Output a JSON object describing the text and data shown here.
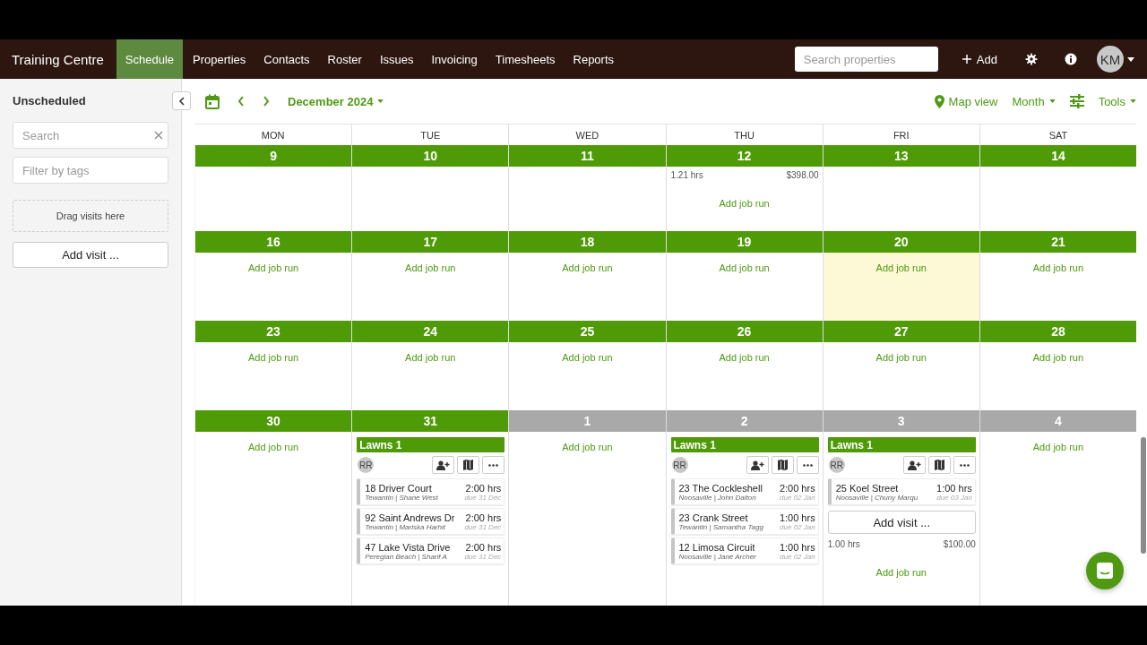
{
  "nav": {
    "brand": "Training Centre",
    "tabs": [
      {
        "label": "Schedule",
        "selected": true
      },
      {
        "label": "Properties",
        "selected": false
      },
      {
        "label": "Contacts",
        "selected": false
      },
      {
        "label": "Roster",
        "selected": false
      },
      {
        "label": "Issues",
        "selected": false
      },
      {
        "label": "Invoicing",
        "selected": false
      },
      {
        "label": "Timesheets",
        "selected": false
      },
      {
        "label": "Reports",
        "selected": false
      }
    ],
    "search": {
      "placeholder": "Search properties"
    },
    "add": "Add",
    "avatar": "KM"
  },
  "sidebar": {
    "title": "Unscheduled",
    "search": {
      "placeholder": "Search"
    },
    "tags": {
      "placeholder": "Filter by tags"
    },
    "drop": "Drag visits here",
    "add_visit": "Add visit ..."
  },
  "toolbar": {
    "period": "December 2024",
    "map_view": "Map view",
    "view": "Month",
    "tools": "Tools"
  },
  "weekdays": [
    "MON",
    "TUE",
    "WED",
    "THU",
    "FRI",
    "SAT"
  ],
  "weeks": [
    {
      "days": [
        {
          "date": "9",
          "other_month": false,
          "highlighted": false
        },
        {
          "date": "10",
          "other_month": false,
          "highlighted": false
        },
        {
          "date": "11",
          "other_month": false,
          "highlighted": false
        },
        {
          "date": "12",
          "other_month": false,
          "highlighted": false,
          "totals": {
            "hours": "1.21 hrs",
            "amount": "$398.00"
          },
          "add_job_run": "Add job run"
        },
        {
          "date": "13",
          "other_month": false,
          "highlighted": false
        },
        {
          "date": "14",
          "other_month": false,
          "highlighted": false
        }
      ]
    },
    {
      "days": [
        {
          "date": "16",
          "other_month": false,
          "highlighted": false,
          "add_job_run": "Add job run"
        },
        {
          "date": "17",
          "other_month": false,
          "highlighted": false,
          "add_job_run": "Add job run"
        },
        {
          "date": "18",
          "other_month": false,
          "highlighted": false,
          "add_job_run": "Add job run"
        },
        {
          "date": "19",
          "other_month": false,
          "highlighted": false,
          "add_job_run": "Add job run"
        },
        {
          "date": "20",
          "other_month": false,
          "highlighted": true,
          "add_job_run": "Add job run"
        },
        {
          "date": "21",
          "other_month": false,
          "highlighted": false,
          "add_job_run": "Add job run"
        }
      ]
    },
    {
      "days": [
        {
          "date": "23",
          "other_month": false,
          "highlighted": false,
          "add_job_run": "Add job run"
        },
        {
          "date": "24",
          "other_month": false,
          "highlighted": false,
          "add_job_run": "Add job run"
        },
        {
          "date": "25",
          "other_month": false,
          "highlighted": false,
          "add_job_run": "Add job run"
        },
        {
          "date": "26",
          "other_month": false,
          "highlighted": false,
          "add_job_run": "Add job run"
        },
        {
          "date": "27",
          "other_month": false,
          "highlighted": false,
          "add_job_run": "Add job run"
        },
        {
          "date": "28",
          "other_month": false,
          "highlighted": false,
          "add_job_run": "Add job run"
        }
      ]
    },
    {
      "days": [
        {
          "date": "30",
          "other_month": false,
          "highlighted": false,
          "add_job_run": "Add job run"
        },
        {
          "date": "31",
          "other_month": false,
          "highlighted": false,
          "runs": [
            {
              "name": "Lawns 1",
              "staff": "RR",
              "visits": [
                {
                  "address": "18 Driver Court",
                  "hours": "2:00 hrs",
                  "meta": "Tewantin | Shane West",
                  "due": "due 31 Dec"
                },
                {
                  "address": "92 Saint Andrews Dr",
                  "hours": "2:00 hrs",
                  "meta": "Tewantin | Mariska Harhit",
                  "due": "due 31 Dec"
                },
                {
                  "address": "47 Lake Vista Drive",
                  "hours": "2:00 hrs",
                  "meta": "Peregian Beach | Sharif A",
                  "due": "due 31 Dec"
                }
              ]
            }
          ]
        },
        {
          "date": "1",
          "other_month": true,
          "highlighted": false,
          "add_job_run": "Add job run"
        },
        {
          "date": "2",
          "other_month": true,
          "highlighted": false,
          "runs": [
            {
              "name": "Lawns 1",
              "staff": "RR",
              "visits": [
                {
                  "address": "23 The Cockleshell",
                  "hours": "2:00 hrs",
                  "meta": "Noosaville | John Dalton",
                  "due": "due 02 Jan"
                },
                {
                  "address": "23 Crank Street",
                  "hours": "1:00 hrs",
                  "meta": "Tewantin | Samantha Tagg",
                  "due": "due 02 Jan"
                },
                {
                  "address": "12 Limosa Circuit",
                  "hours": "1:00 hrs",
                  "meta": "Noosaville | Jane Archer",
                  "due": "due 02 Jan"
                }
              ]
            }
          ]
        },
        {
          "date": "3",
          "other_month": true,
          "highlighted": false,
          "runs": [
            {
              "name": "Lawns 1",
              "staff": "RR",
              "visits": [
                {
                  "address": "25 Koel Street",
                  "hours": "1:00 hrs",
                  "meta": "Noosaville | Chuny Marqu",
                  "due": "due 03 Jan"
                }
              ],
              "add_visit": "Add visit ..."
            }
          ],
          "totals": {
            "hours": "1.00 hrs",
            "amount": "$100.00"
          },
          "add_job_run": "Add job run"
        },
        {
          "date": "4",
          "other_month": true,
          "highlighted": false,
          "add_job_run": "Add job run"
        }
      ]
    }
  ]
}
